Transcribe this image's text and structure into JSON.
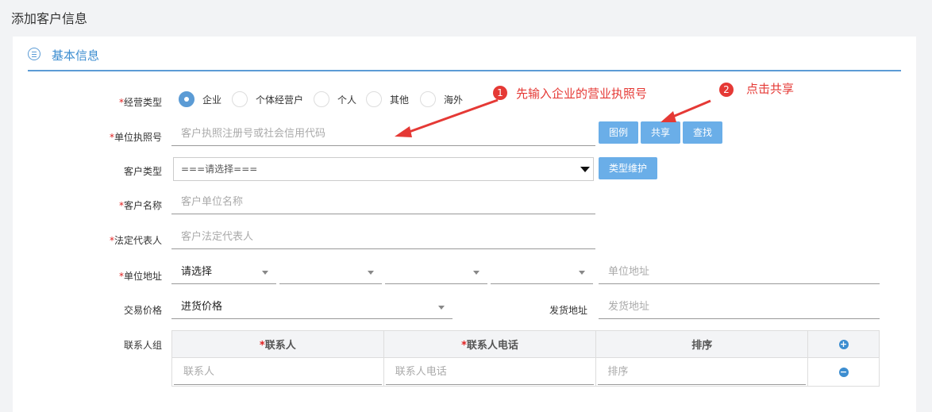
{
  "page": {
    "title": "添加客户信息"
  },
  "section": {
    "title": "基本信息",
    "icon": "list-icon"
  },
  "form": {
    "business_type": {
      "label": "经营类型",
      "options": [
        "企业",
        "个体经营户",
        "个人",
        "其他",
        "海外"
      ],
      "selected": "企业"
    },
    "license": {
      "label": "单位执照号",
      "placeholder": "客户执照注册号或社会信用代码",
      "buttons": {
        "example": "图例",
        "share": "共享",
        "search": "查找"
      }
    },
    "customer_type": {
      "label": "客户类型",
      "value": "===请选择===",
      "button": "类型维护"
    },
    "customer_name": {
      "label": "客户名称",
      "placeholder": "客户单位名称"
    },
    "legal_rep": {
      "label": "法定代表人",
      "placeholder": "客户法定代表人"
    },
    "address": {
      "label": "单位地址",
      "province": "请选择",
      "placeholder": "单位地址"
    },
    "price": {
      "label": "交易价格",
      "value": "进货价格"
    },
    "ship_address": {
      "label": "发货地址",
      "placeholder": "发货地址"
    },
    "contacts": {
      "label": "联系人组",
      "headers": [
        "联系人",
        "联系人电话",
        "排序"
      ],
      "placeholders": [
        "联系人",
        "联系人电话",
        "排序"
      ]
    }
  },
  "annotations": {
    "step1": {
      "num": "1",
      "text": "先输入企业的营业执照号"
    },
    "step2": {
      "num": "2",
      "text": "点击共享"
    }
  },
  "colors": {
    "accent": "#5b9bd5",
    "button": "#6aaee8",
    "annotation": "#e53935",
    "required": "#e02020"
  }
}
